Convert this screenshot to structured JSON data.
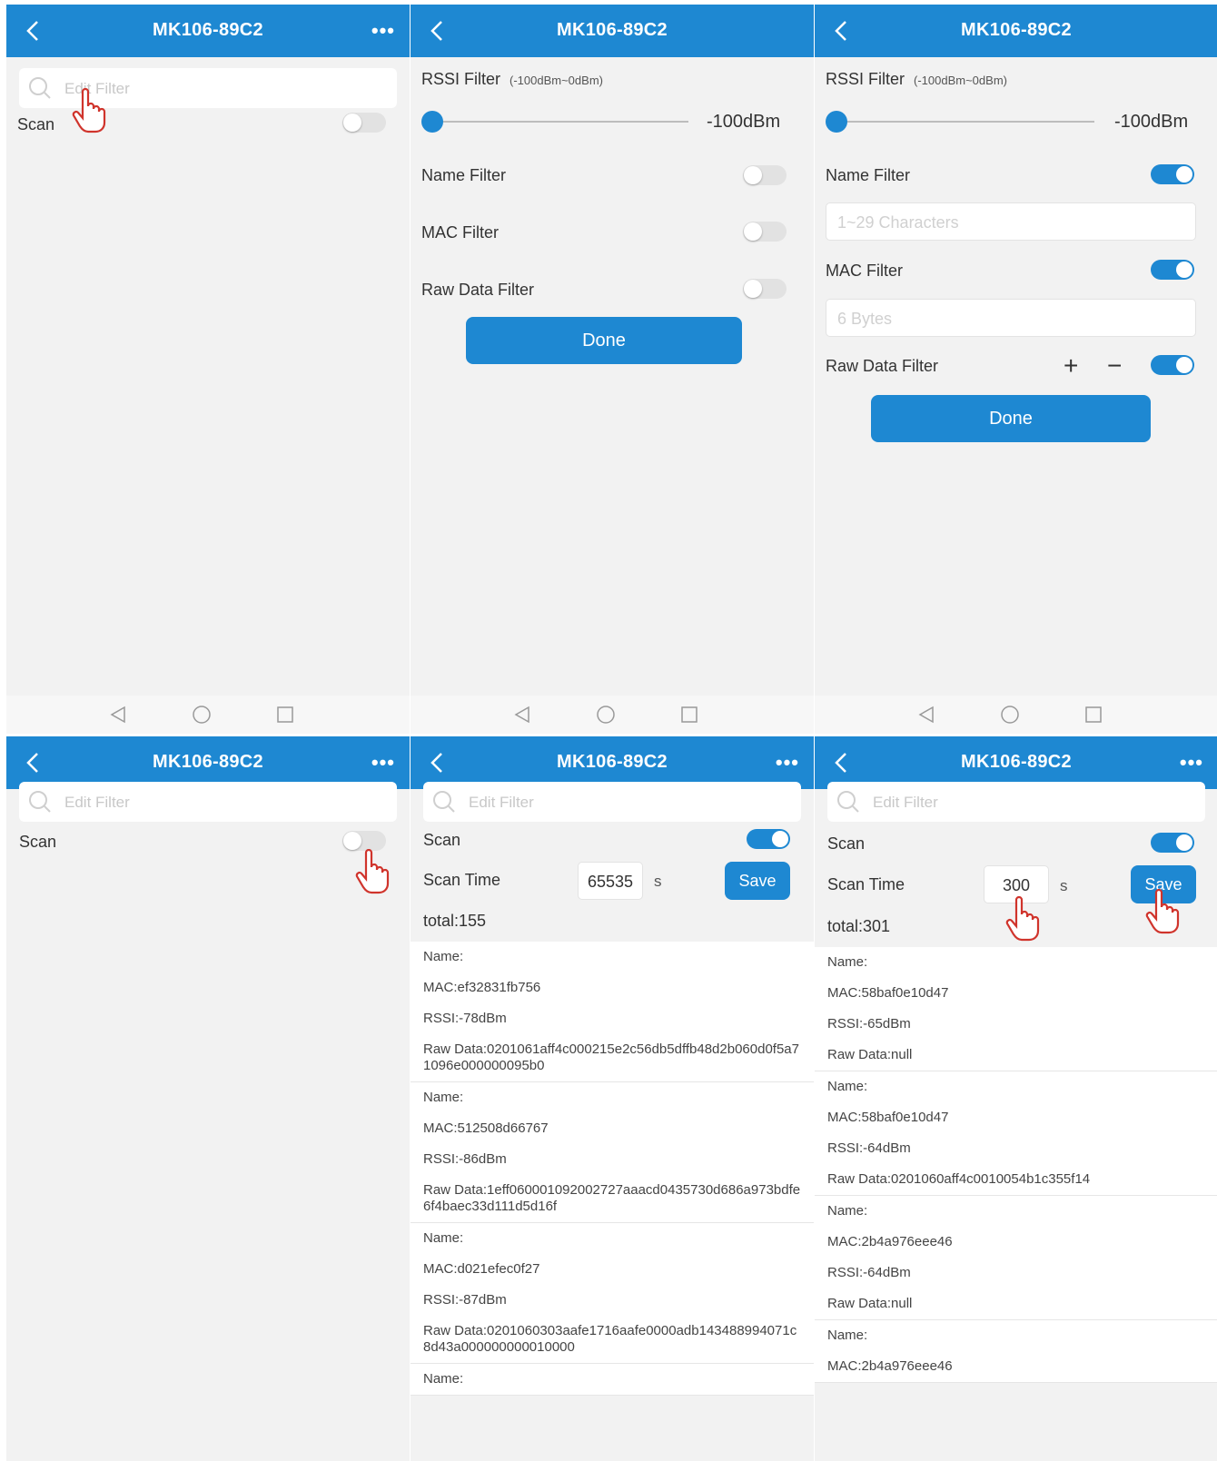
{
  "device_title": "MK106-89C2",
  "more_label": "•••",
  "search_placeholder": "Edit Filter",
  "scan_label": "Scan",
  "filter": {
    "rssi_label": "RSSI Filter",
    "rssi_range": "(-100dBm~0dBm)",
    "rssi_value": "-100dBm",
    "rssi_fraction": 0,
    "name_label": "Name Filter",
    "mac_label": "MAC Filter",
    "raw_label": "Raw Data Filter",
    "name_placeholder": "1~29 Characters",
    "mac_placeholder": "6 Bytes",
    "plus": "+",
    "minus": "−",
    "done_label": "Done"
  },
  "scan_time_label": "Scan Time",
  "seconds_label": "s",
  "save_label": "Save",
  "screen5": {
    "scan_time": "65535",
    "total": "total:155",
    "devices": [
      {
        "name": "Name:",
        "mac": "MAC:ef32831fb756",
        "rssi": "RSSI:-78dBm",
        "raw": "Raw Data:0201061aff4c000215e2c56db5dffb48d2b060d0f5a71096e000000095b0"
      },
      {
        "name": "Name:",
        "mac": "MAC:512508d66767",
        "rssi": "RSSI:-86dBm",
        "raw": "Raw Data:1eff060001092002727aaacd0435730d686a973bdfe6f4baec33d111d5d16f"
      },
      {
        "name": "Name:",
        "mac": "MAC:d021efec0f27",
        "rssi": "RSSI:-87dBm",
        "raw": "Raw Data:0201060303aafe1716aafe0000adb143488994071c8d43a000000000010000"
      },
      {
        "name": "Name:",
        "mac": "",
        "rssi": "",
        "raw": ""
      }
    ]
  },
  "screen6": {
    "scan_time": "300",
    "total": "total:301",
    "devices": [
      {
        "name": "Name:",
        "mac": "MAC:58baf0e10d47",
        "rssi": "RSSI:-65dBm",
        "raw": "Raw Data:null"
      },
      {
        "name": "Name:",
        "mac": "MAC:58baf0e10d47",
        "rssi": "RSSI:-64dBm",
        "raw": "Raw Data:0201060aff4c0010054b1c355f14"
      },
      {
        "name": "Name:",
        "mac": "MAC:2b4a976eee46",
        "rssi": "RSSI:-64dBm",
        "raw": "Raw Data:null"
      },
      {
        "name": "Name:",
        "mac": "MAC:2b4a976eee46",
        "rssi": "",
        "raw": ""
      }
    ]
  },
  "colors": {
    "accent": "#1e88d2",
    "background": "#f2f2f2",
    "cursor_hand": "#d0342c"
  },
  "icons": [
    "back-arrow-icon",
    "more-icon",
    "search-icon",
    "nav-back-icon",
    "nav-home-icon",
    "nav-recents-icon",
    "pointer-hand-icon"
  ]
}
